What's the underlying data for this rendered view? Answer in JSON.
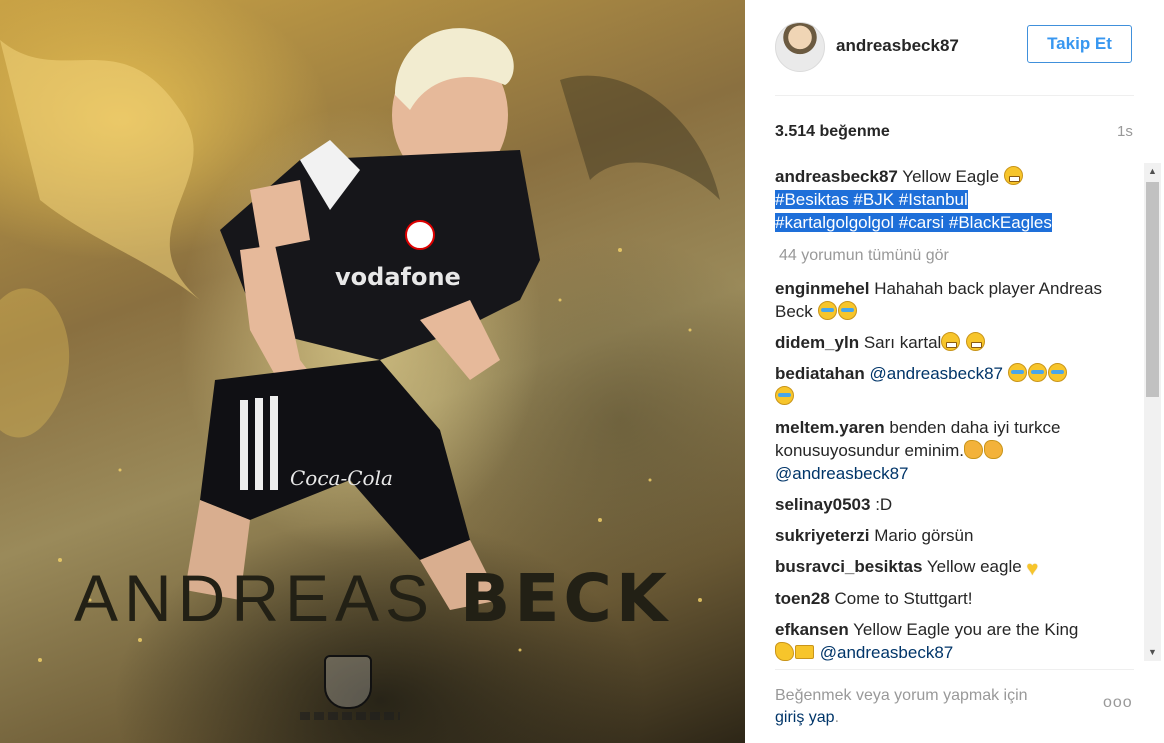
{
  "image": {
    "overlay_first_name": "ANDREAS",
    "overlay_last_name": "BECK",
    "jersey_sponsor": "vodafone",
    "shorts_sponsor": "Coca-Cola"
  },
  "post": {
    "username": "andreasbeck87",
    "follow_label": "Takip Et",
    "likes": "3.514 beğenme",
    "timestamp": "1s",
    "caption": {
      "author": "andreasbeck87",
      "text": "Yellow Eagle",
      "hashtags_line1": "#Besiktas #BJK #Istanbul",
      "hashtags_line2": "#kartalgolgolgol #carsi #BlackEagles"
    },
    "view_all_comments": "44 yorumun tümünü gör",
    "comments": [
      {
        "author": "enginmehel",
        "text": "Hahahah back player Andreas Beck"
      },
      {
        "author": "didem_yln",
        "text": "Sarı kartal"
      },
      {
        "author": "bediatahan",
        "mention": "@andreasbeck87"
      },
      {
        "author": "meltem.yaren",
        "text": "benden daha iyi turkce konusuyosundur eminim.",
        "mention": "@andreasbeck87"
      },
      {
        "author": "selinay0503",
        "text": ":D"
      },
      {
        "author": "sukriyeterzi",
        "text": "Mario görsün"
      },
      {
        "author": "busravci_besiktas",
        "text": "Yellow eagle"
      },
      {
        "author": "toen28",
        "text": "Come to Stuttgart!"
      },
      {
        "author": "efkansen",
        "text": "Yellow Eagle you are the King",
        "mention": "@andreasbeck87"
      }
    ],
    "login_prompt": "Beğenmek veya yorum yapmak için",
    "login_link": "giriş yap",
    "login_suffix": ".",
    "more_options": "ooo"
  },
  "colors": {
    "follow_blue": "#3897f0",
    "hashtag_highlight": "#1e6fd9",
    "mention_blue": "#003569"
  }
}
